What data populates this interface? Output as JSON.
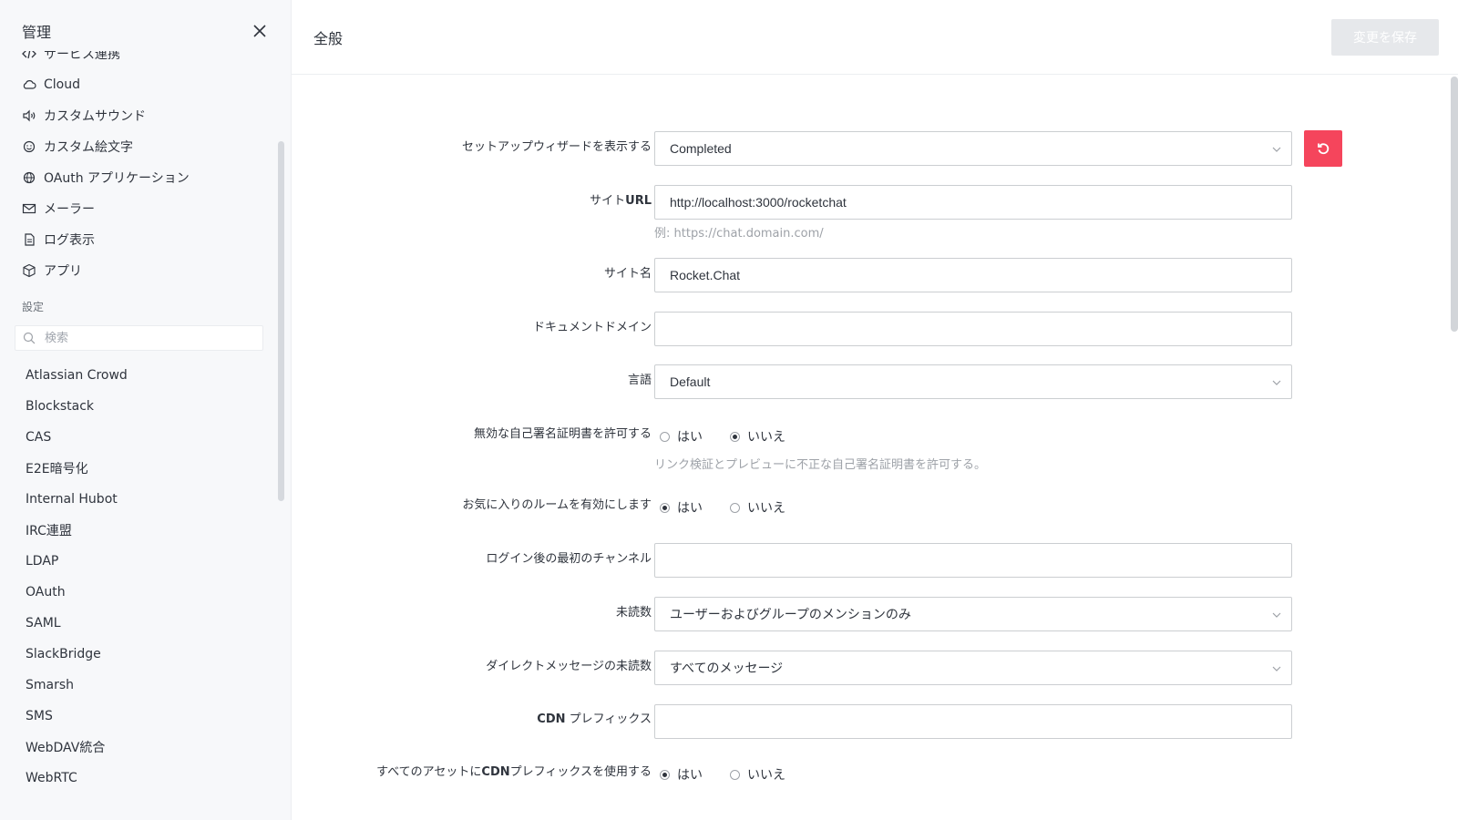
{
  "sidebar": {
    "title": "管理",
    "admin_items": [
      {
        "label": "サービス連携",
        "icon": "code-icon"
      },
      {
        "label": "Cloud",
        "icon": "cloud-icon"
      },
      {
        "label": "カスタムサウンド",
        "icon": "volume-icon"
      },
      {
        "label": "カスタム絵文字",
        "icon": "emoji-icon"
      },
      {
        "label": "OAuth アプリケーション",
        "icon": "globe-icon"
      },
      {
        "label": "メーラー",
        "icon": "mail-icon"
      },
      {
        "label": "ログ表示",
        "icon": "document-icon"
      },
      {
        "label": "アプリ",
        "icon": "cube-icon"
      }
    ],
    "settings_section": "設定",
    "search_placeholder": "検索",
    "settings_items": [
      "Atlassian Crowd",
      "Blockstack",
      "CAS",
      "E2E暗号化",
      "Internal Hubot",
      "IRC連盟",
      "LDAP",
      "OAuth",
      "SAML",
      "SlackBridge",
      "Smarsh",
      "SMS",
      "WebDAV統合",
      "WebRTC"
    ]
  },
  "header": {
    "title": "全般",
    "save_label": "変更を保存"
  },
  "form": {
    "setup_wizard": {
      "label": "セットアップウィザードを表示する",
      "value": "Completed"
    },
    "site_url": {
      "label_prefix": "サイト",
      "label_bold": "URL",
      "value": "http://localhost:3000/rocketchat",
      "hint": "例: https://chat.domain.com/"
    },
    "site_name": {
      "label": "サイト名",
      "value": "Rocket.Chat"
    },
    "document_domain": {
      "label": "ドキュメントドメイン",
      "value": ""
    },
    "language": {
      "label": "言語",
      "value": "Default"
    },
    "invalid_cert": {
      "label": "無効な自己署名証明書を許可する",
      "yes": "はい",
      "no": "いいえ",
      "selected": "no",
      "hint": "リンク検証とプレビューに不正な自己署名証明書を許可する。"
    },
    "favorites": {
      "label": "お気に入りのルームを有効にします",
      "yes": "はい",
      "no": "いいえ",
      "selected": "yes"
    },
    "first_channel": {
      "label": "ログイン後の最初のチャンネル",
      "value": ""
    },
    "unread_count": {
      "label": "未読数",
      "value": "ユーザーおよびグループのメンションのみ"
    },
    "dm_unread_count": {
      "label": "ダイレクトメッセージの未読数",
      "value": "すべてのメッセージ"
    },
    "cdn_prefix": {
      "label_bold": "CDN",
      "label_suffix": " プレフィックス",
      "value": ""
    },
    "cdn_all_assets": {
      "label_prefix": "すべてのアセットに",
      "label_bold": "CDN",
      "label_suffix": "プレフィックスを使用する",
      "yes": "はい",
      "no": "いいえ",
      "selected": "yes"
    }
  },
  "colors": {
    "sidebar_bg": "#f7f8fa",
    "reset_button": "#f5455c",
    "save_button_disabled": "#e6e8eb"
  }
}
